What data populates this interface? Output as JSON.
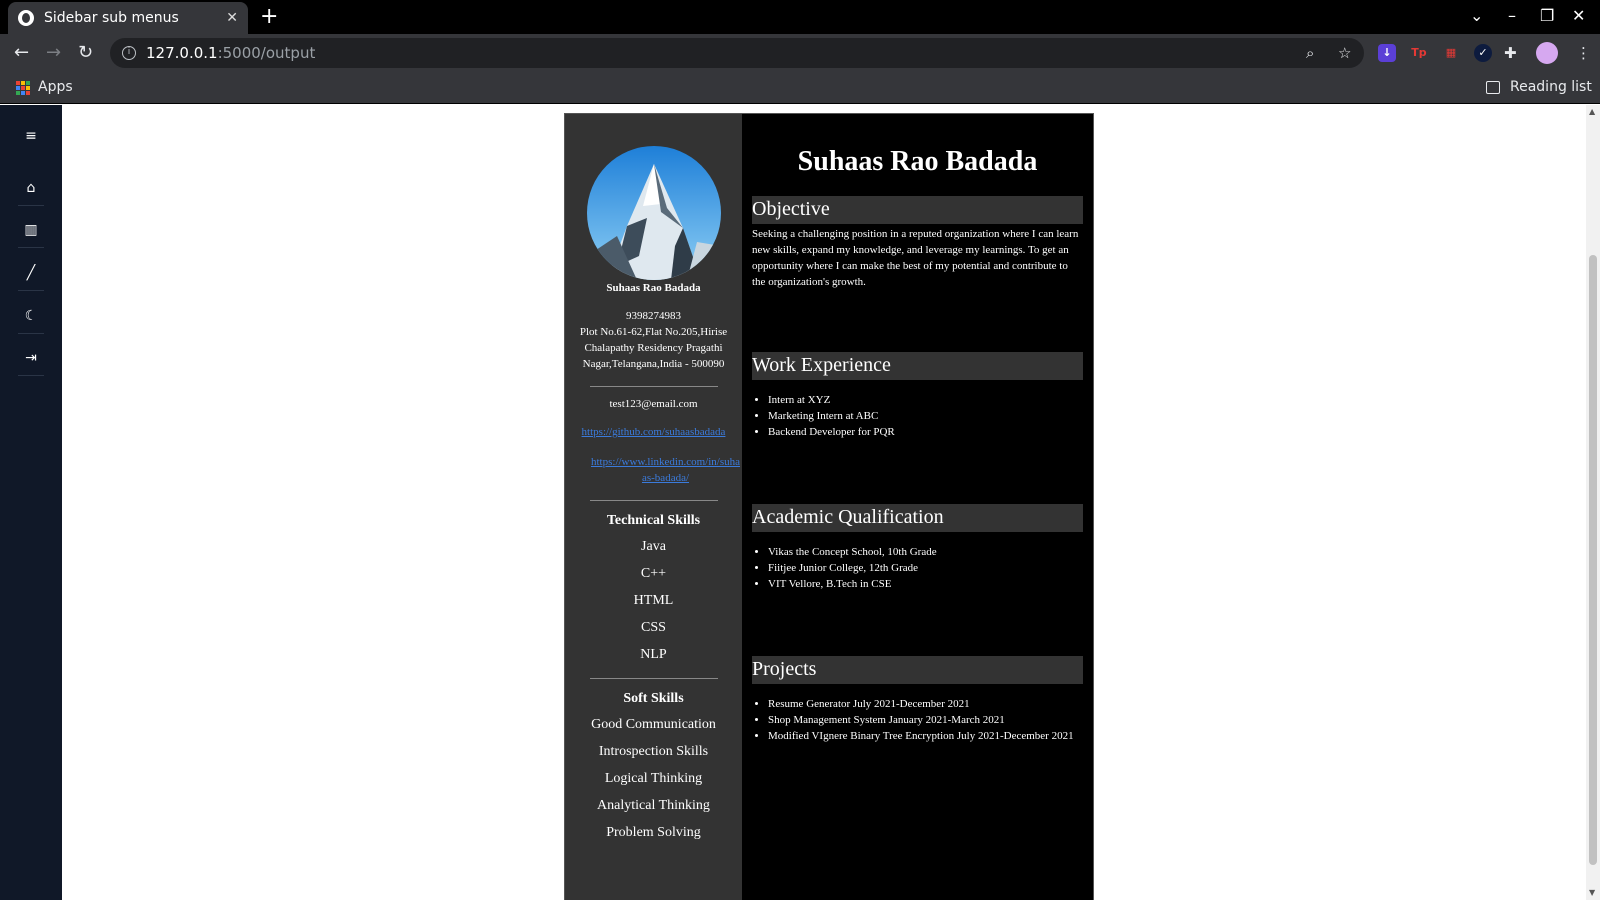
{
  "browser": {
    "tab_title": "Sidebar sub menus",
    "tab_close": "✕",
    "new_tab": "+",
    "url_host": "127.0.0.1",
    "url_path": ":5000/output",
    "apps_label": "Apps",
    "reading_list_label": "Reading list"
  },
  "sidebar": {
    "items": [
      {
        "icon": "menu-icon",
        "glyph": "≡"
      },
      {
        "icon": "home-icon",
        "glyph": "⌂"
      },
      {
        "icon": "library-icon",
        "glyph": "▥"
      },
      {
        "icon": "pen-icon",
        "glyph": "╱"
      },
      {
        "icon": "moon-icon",
        "glyph": "☾"
      },
      {
        "icon": "logout-icon",
        "glyph": "⇥"
      }
    ]
  },
  "resume": {
    "left": {
      "name": "Suhaas Rao Badada",
      "phone": "9398274983",
      "address": "Plot No.61-62,Flat No.205,Hirise Chalapathy Residency Pragathi Nagar,Telangana,India - 500090",
      "email": "test123@email.com",
      "github": "https://github.com/suhaasbadada",
      "linkedin": "https://www.linkedin.com/in/suhaas-badada/",
      "technical_title": "Technical Skills",
      "technical_skills": [
        "Java",
        "C++",
        "HTML",
        "CSS",
        "NLP"
      ],
      "soft_title": "Soft Skills",
      "soft_skills": [
        "Good Communication",
        "Introspection Skills",
        "Logical Thinking",
        "Analytical Thinking",
        "Problem Solving"
      ]
    },
    "right": {
      "name": "Suhaas Rao Badada",
      "objective_title": "Objective",
      "objective_text": "Seeking a challenging position in a reputed organization where I can learn new skills, expand my knowledge, and leverage my learnings. To get an opportunity where I can make the best of my potential and contribute to the organization's growth.",
      "work_title": "Work Experience",
      "work": [
        "Intern at XYZ",
        "Marketing Intern at ABC",
        "Backend Developer for PQR"
      ],
      "academic_title": "Academic Qualification",
      "academic": [
        "Vikas the Concept School, 10th Grade",
        "Fiitjee Junior College, 12th Grade",
        "VIT Vellore, B.Tech in CSE"
      ],
      "projects_title": "Projects",
      "projects": [
        "Resume Generator July 2021-December 2021",
        "Shop Management System January 2021-March 2021",
        "Modified VIgnere Binary Tree Encryption July 2021-December 2021"
      ]
    }
  }
}
